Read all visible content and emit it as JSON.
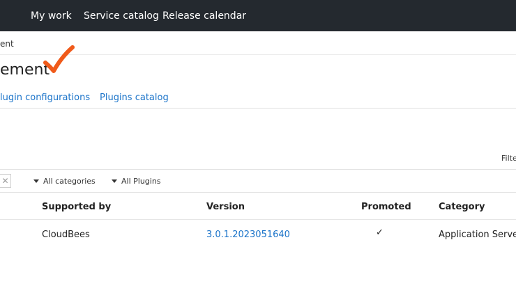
{
  "topnav": {
    "items": [
      "My work",
      "Service catalog",
      "Release calendar"
    ]
  },
  "breadcrumb": "ent",
  "page": {
    "title": "ement"
  },
  "tabs": [
    "lugin configurations",
    "Plugins catalog"
  ],
  "filter_label": "Filte",
  "filters": {
    "clear_glyph": "✕",
    "category": "All categories",
    "plugins": "All Plugins"
  },
  "table": {
    "columns": [
      "Supported by",
      "Version",
      "Promoted",
      "Category"
    ],
    "rows": [
      {
        "supported_by": "CloudBees",
        "version": "3.0.1.2023051640",
        "promoted": "✓",
        "category": "Application Server"
      }
    ]
  },
  "colors": {
    "nav_bg": "#24292f",
    "link": "#1a73c9",
    "annotation": "#f05a1a"
  },
  "icons": {
    "annotation": "checkmark-annotation-icon",
    "promoted": "check-icon",
    "clear": "close-icon",
    "dropdown": "caret-down-icon"
  }
}
